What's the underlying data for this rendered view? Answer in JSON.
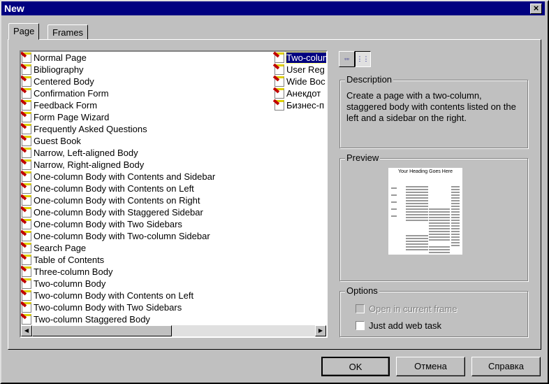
{
  "title": "New",
  "tabs": [
    "Page",
    "Frames"
  ],
  "templates_col1": [
    "Normal Page",
    "Bibliography",
    "Centered Body",
    "Confirmation Form",
    "Feedback Form",
    "Form Page Wizard",
    "Frequently Asked Questions",
    "Guest Book",
    "Narrow, Left-aligned Body",
    "Narrow, Right-aligned Body",
    "One-column Body with Contents and Sidebar",
    "One-column Body with Contents on Left",
    "One-column Body with Contents on Right",
    "One-column Body with Staggered Sidebar",
    "One-column Body with Two Sidebars",
    "One-column Body with Two-column Sidebar",
    "Search Page",
    "Table of Contents",
    "Three-column Body",
    "Two-column Body",
    "Two-column Body with Contents on Left",
    "Two-column Body with Two Sidebars",
    "Two-column Staggered Body"
  ],
  "templates_col2": [
    "Two-colum",
    "User Reg",
    "Wide Boc",
    "Анекдот",
    "Бизнес-п"
  ],
  "selected": "Two-colum",
  "description": {
    "label": "Description",
    "text": "Create a page with a two-column, staggered body with contents listed on the left and a sidebar on the right."
  },
  "preview": {
    "label": "Preview",
    "heading": "Your Heading Goes Here"
  },
  "options": {
    "label": "Options",
    "open_in_frame": "Open in current frame",
    "just_add_task": "Just add web task"
  },
  "buttons": {
    "ok": "OK",
    "cancel": "Отмена",
    "help": "Справка"
  }
}
